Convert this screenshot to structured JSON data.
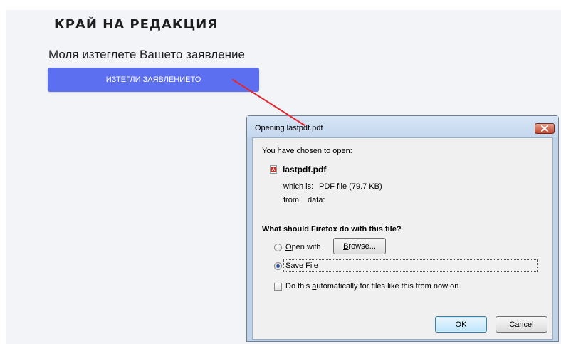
{
  "page": {
    "heading": "КРАЙ НА РЕДАКЦИЯ",
    "prompt": "Моля изтеглете Вашето заявление",
    "download_button": "ИЗТЕГЛИ ЗАЯВЛЕНИЕТО",
    "button_color": "#5c6ff0",
    "arrow_color": "#e8262d"
  },
  "dialog": {
    "title": "Opening lastpdf.pdf",
    "close_icon": "close-x-icon",
    "chosen_text": "You have chosen to open:",
    "file_icon": "pdf-file-icon",
    "file_name": "lastpdf.pdf",
    "which_is_label": "which is:",
    "which_is_value": "PDF file (79.7 KB)",
    "from_label": "from:",
    "from_value": "data:",
    "question": "What should Firefox do with this file?",
    "open_with": {
      "prefix_u": "O",
      "rest": "pen with",
      "selected": false
    },
    "browse_button": {
      "prefix_u": "B",
      "rest": "rowse..."
    },
    "save_file": {
      "prefix_u": "S",
      "rest": "ave File",
      "selected": true
    },
    "auto_checkbox": {
      "before": "Do this ",
      "underlined": "a",
      "after": "utomatically for files like this from now on.",
      "checked": false
    },
    "ok_button": "OK",
    "cancel_button": "Cancel"
  }
}
